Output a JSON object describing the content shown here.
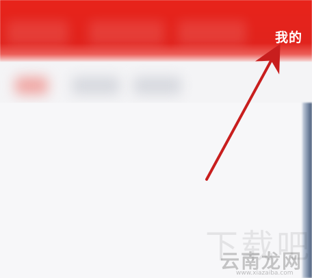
{
  "header": {
    "active_tab_label": "我的",
    "color": "#e1231d"
  },
  "annotation": {
    "arrow_color": "#c81e1e"
  },
  "watermark": {
    "main_text": "云南龙网",
    "ghost_text": "下载吧",
    "url_text": "www.xiazaiba.com"
  }
}
